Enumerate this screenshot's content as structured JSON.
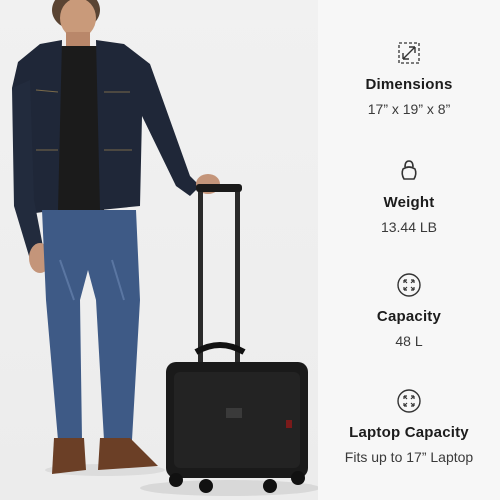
{
  "specs": [
    {
      "icon": "resize-arrows-icon",
      "label": "Dimensions",
      "value": "17” x 19” x 8”"
    },
    {
      "icon": "kettlebell-icon",
      "label": "Weight",
      "value": "13.44 LB"
    },
    {
      "icon": "expand-circle-icon",
      "label": "Capacity",
      "value": "48 L"
    },
    {
      "icon": "expand-circle-icon",
      "label": "Laptop Capacity",
      "value": "Fits up to 17” Laptop"
    }
  ]
}
